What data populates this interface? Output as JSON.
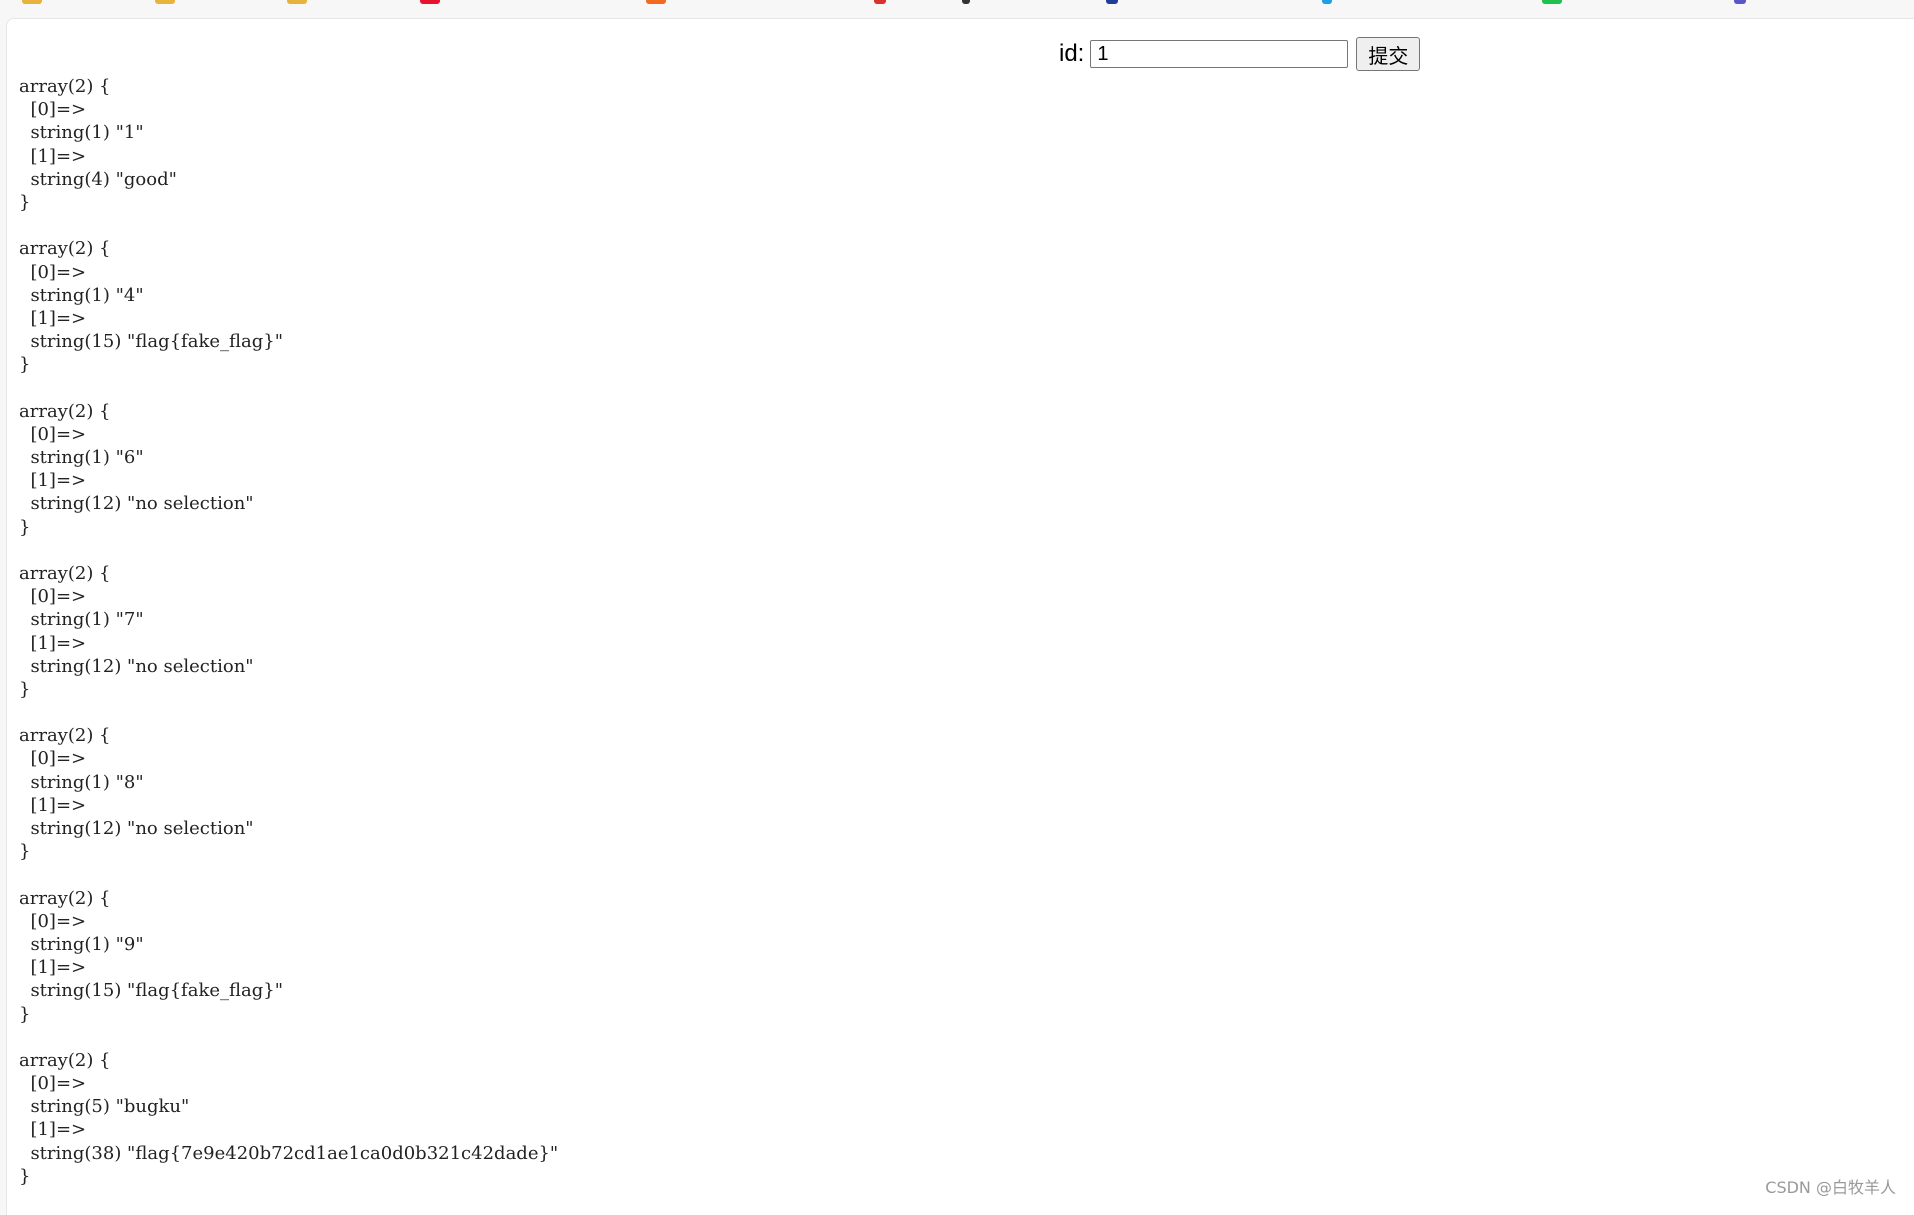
{
  "bookmark_colors": [
    "#e8b33a",
    "#e8b33a",
    "#e8b33a",
    "#e8132d",
    "#f26a22",
    "#d9322b",
    "#333333",
    "#1f3d99",
    "#1aa0e6",
    "#1fc14c",
    "#5a56c8"
  ],
  "form": {
    "id_label": "id:",
    "id_value": "1",
    "submit_label": "提交"
  },
  "dumps": [
    {
      "lines": [
        "array(2) {",
        "  [0]=>",
        "  string(1) \"1\"",
        "  [1]=>",
        "  string(4) \"good\"",
        "}"
      ]
    },
    {
      "lines": [
        "array(2) {",
        "  [0]=>",
        "  string(1) \"4\"",
        "  [1]=>",
        "  string(15) \"flag{fake_flag}\"",
        "}"
      ]
    },
    {
      "lines": [
        "array(2) {",
        "  [0]=>",
        "  string(1) \"6\"",
        "  [1]=>",
        "  string(12) \"no selection\"",
        "}"
      ]
    },
    {
      "lines": [
        "array(2) {",
        "  [0]=>",
        "  string(1) \"7\"",
        "  [1]=>",
        "  string(12) \"no selection\"",
        "}"
      ]
    },
    {
      "lines": [
        "array(2) {",
        "  [0]=>",
        "  string(1) \"8\"",
        "  [1]=>",
        "  string(12) \"no selection\"",
        "}"
      ]
    },
    {
      "lines": [
        "array(2) {",
        "  [0]=>",
        "  string(1) \"9\"",
        "  [1]=>",
        "  string(15) \"flag{fake_flag}\"",
        "}"
      ]
    },
    {
      "lines": [
        "array(2) {",
        "  [0]=>",
        "  string(5) \"bugku\"",
        "  [1]=>",
        "  string(38) \"flag{7e9e420b72cd1ae1ca0d0b321c42dade}\"",
        "}"
      ]
    }
  ],
  "watermark": "CSDN @白牧羊人"
}
